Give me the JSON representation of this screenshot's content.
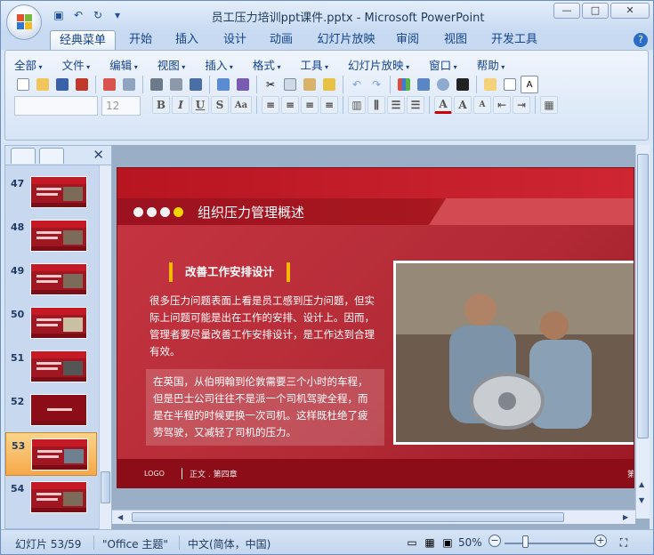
{
  "window": {
    "title": "员工压力培训ppt课件.pptx - Microsoft PowerPoint",
    "controls": [
      "—",
      "□",
      "✕"
    ]
  },
  "tabs": [
    "经典菜单",
    "开始",
    "插入",
    "设计",
    "动画",
    "幻灯片放映",
    "审阅",
    "视图",
    "开发工具"
  ],
  "active_tab": "经典菜单",
  "classic_menus": [
    "全部",
    "文件",
    "编辑",
    "视图",
    "插入",
    "格式",
    "工具",
    "幻灯片放映",
    "窗口",
    "帮助"
  ],
  "font_size_value": "12",
  "format_buttons": [
    "B",
    "I",
    "U",
    "S",
    "Aa"
  ],
  "thumbnails": [
    {
      "num": "47"
    },
    {
      "num": "48"
    },
    {
      "num": "49"
    },
    {
      "num": "50"
    },
    {
      "num": "51"
    },
    {
      "num": "52"
    },
    {
      "num": "53"
    },
    {
      "num": "54"
    }
  ],
  "selected_slide": "53",
  "slide": {
    "title": "组织压力管理概述",
    "subheading": "改善工作安排设计",
    "paragraph": "很多压力问题表面上看是员工感到压力问题，但实际上问题可能是出在工作的安排、设计上。因而，管理者要尽量改善工作安排设计，是工作达到合理有效。",
    "box_text": "在英国，从伯明翰到伦敦需要三个小时的车程，但是巴士公司往往不是派一个司机驾驶全程，而是在半程的时候更换一次司机。这样既杜绝了疲劳驾驶，又减轻了司机的压力。",
    "footer_logo": "LOGO",
    "footer_chapter": "正文 . 第四章",
    "footer_page": "第"
  },
  "status": {
    "slide_info": "幻灯片 53/59",
    "theme": "\"Office 主题\"",
    "language": "中文(简体，中国)",
    "zoom": "50%"
  },
  "colors": {
    "slide_red": "#c8222d",
    "accent_yellow": "#f5b800",
    "selection_orange": "#f6a84a"
  }
}
